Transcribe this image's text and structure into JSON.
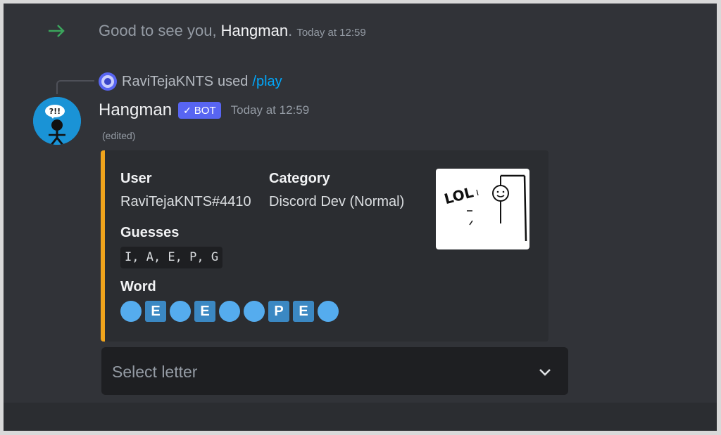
{
  "system_message": {
    "prefix": "Good to see you, ",
    "name": "Hangman",
    "suffix": ".",
    "timestamp": "Today at 12:59",
    "arrow_icon": "join-arrow-icon",
    "arrow_color": "#3ba55c"
  },
  "reply": {
    "user": "RaviTejaKNTS",
    "used": "used",
    "command": "/play"
  },
  "message": {
    "author": "Hangman",
    "bot_tag": "BOT",
    "timestamp": "Today at 12:59",
    "edited": "(edited)"
  },
  "embed": {
    "accent_color": "#f0a41c",
    "fields": {
      "user_name": "User",
      "user_value": "RaviTejaKNTS#4410",
      "category_name": "Category",
      "category_value": "Discord Dev (Normal)",
      "guesses_name": "Guesses",
      "guesses_value": "I, A, E, P, G",
      "word_name": "Word"
    },
    "word": [
      "",
      "E",
      "",
      "E",
      "",
      "",
      "P",
      "E",
      ""
    ],
    "thumbnail_text": "LOL"
  },
  "select_menu": {
    "placeholder": "Select letter"
  }
}
